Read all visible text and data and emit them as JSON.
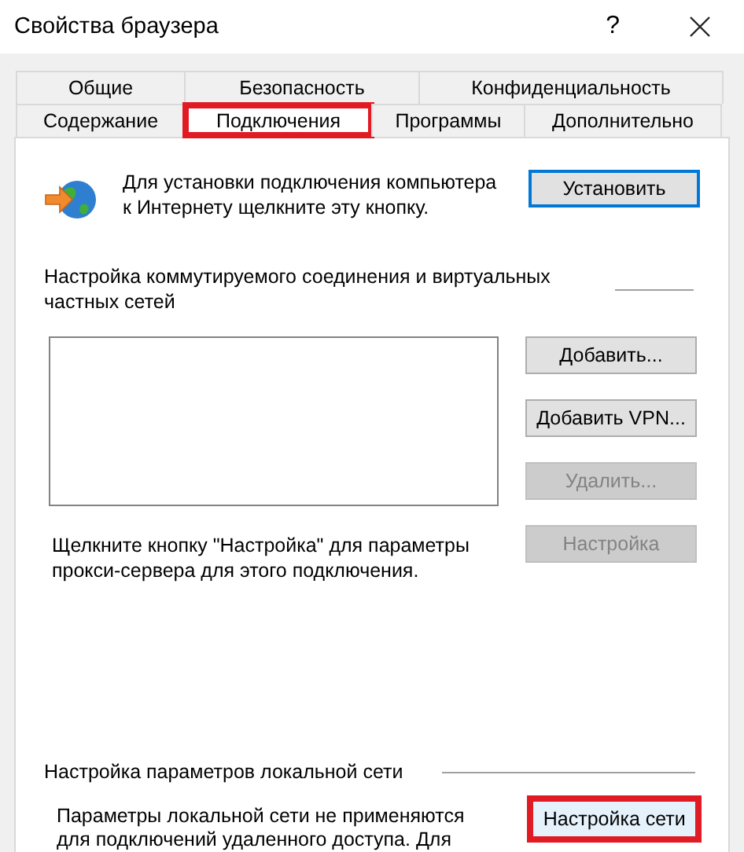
{
  "window": {
    "title": "Свойства браузера",
    "help": "?"
  },
  "tab_rows": [
    [
      {
        "label": "Общие",
        "selected": false,
        "highlighted": false
      },
      {
        "label": "Безопасность",
        "selected": false,
        "highlighted": false
      },
      {
        "label": "Конфиденциальность",
        "selected": false,
        "highlighted": false
      }
    ],
    [
      {
        "label": "Содержание",
        "selected": false,
        "highlighted": false
      },
      {
        "label": "Подключения",
        "selected": true,
        "highlighted": true
      },
      {
        "label": "Программы",
        "selected": false,
        "highlighted": false
      },
      {
        "label": "Дополнительно",
        "selected": false,
        "highlighted": false
      }
    ]
  ],
  "setup": {
    "text": "Для установки подключения компьютера к Интернету щелкните эту кнопку.",
    "button": {
      "label": "Установить",
      "default": true
    }
  },
  "dialup": {
    "label": "Настройка коммутируемого соединения и виртуальных частных сетей",
    "buttons": [
      {
        "label": "Добавить...",
        "disabled": false
      },
      {
        "label": "Добавить VPN...",
        "disabled": false
      },
      {
        "label": "Удалить...",
        "disabled": true
      },
      {
        "label": "Настройка",
        "disabled": true
      }
    ],
    "proxy_text": "Щелкните кнопку \"Настройка\" для параметры прокси-сервера для этого подключения."
  },
  "lan": {
    "label": "Настройка параметров локальной сети",
    "text": "Параметры локальной сети не применяются для подключений удаленного доступа. Для",
    "button": {
      "label": "Настройка сети",
      "hovered": true,
      "highlighted": true
    }
  }
}
